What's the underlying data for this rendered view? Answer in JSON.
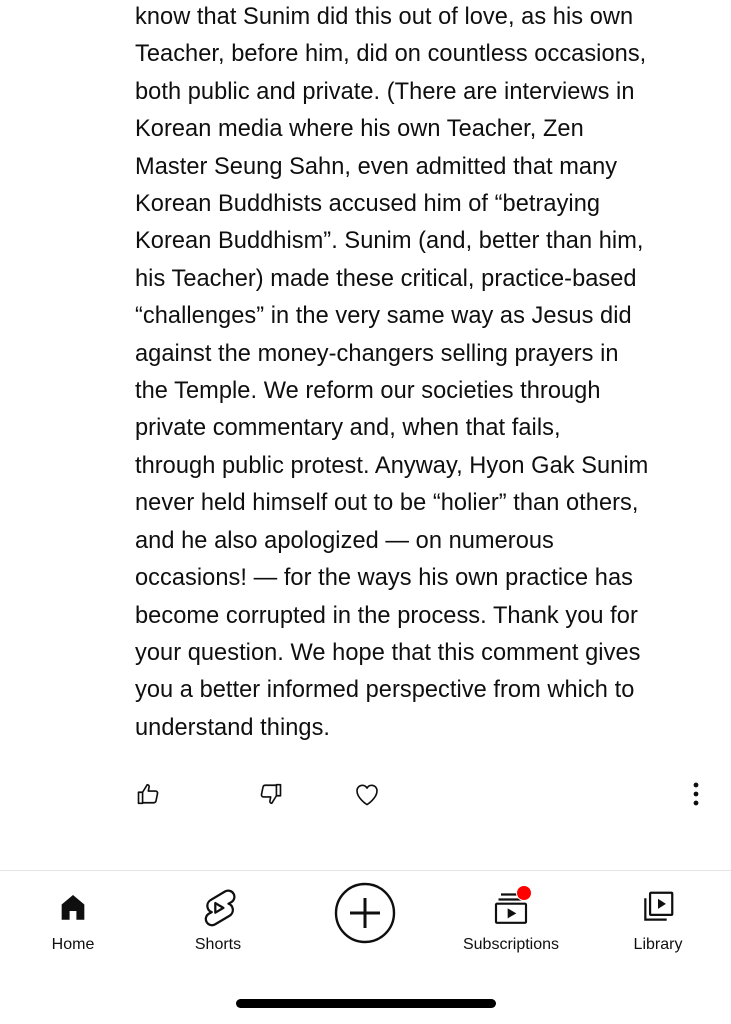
{
  "comment": {
    "lines": [
      "know that Sunim did this out of love, as his own",
      "Teacher, before him, did on countless occasions,",
      "both public and private. (There are interviews in",
      "Korean media where his own Teacher, Zen",
      "Master Seung Sahn, even admitted that many",
      "Korean Buddhists accused him of “betraying",
      "Korean Buddhism”. Sunim (and, better than him,",
      "his Teacher) made these critical, practice-based",
      "“challenges” in the very same way as Jesus did",
      "against the money-changers selling prayers in",
      "the Temple. We reform our societies through",
      "private commentary and, when that fails,",
      "through public protest. Anyway, Hyon Gak Sunim",
      "never held himself out to be “holier” than others,",
      "and he also apologized — on numerous",
      "occasions! — for the ways his own practice has",
      "become corrupted in the process. Thank you for",
      "your question. We hope that this comment gives",
      "you a better informed perspective from which to",
      "understand things."
    ]
  },
  "actions": {
    "like_icon": "thumbs-up-icon",
    "dislike_icon": "thumbs-down-icon",
    "heart_icon": "heart-icon",
    "more_icon": "more-vertical-icon"
  },
  "bottom_nav": {
    "items": [
      {
        "label": "Home",
        "icon": "home-icon",
        "active": true
      },
      {
        "label": "Shorts",
        "icon": "shorts-icon",
        "active": false
      },
      {
        "label": "",
        "icon": "create-plus-icon",
        "active": false
      },
      {
        "label": "Subscriptions",
        "icon": "subscriptions-icon",
        "active": false,
        "has_notification": true
      },
      {
        "label": "Library",
        "icon": "library-icon",
        "active": false
      }
    ]
  },
  "colors": {
    "text": "#0f0f0f",
    "divider": "#e5e5e5",
    "notification": "#ff0000",
    "background": "#ffffff"
  }
}
